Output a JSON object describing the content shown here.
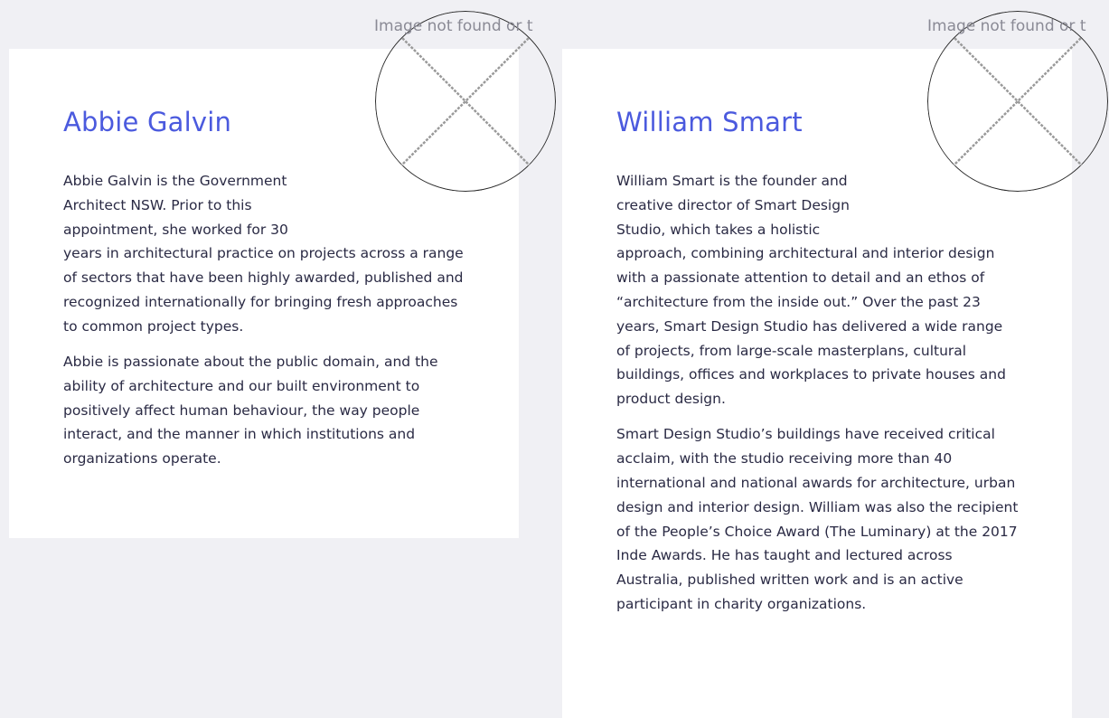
{
  "profiles": [
    {
      "name": "Abbie Galvin",
      "image_alt": "Image not found or t",
      "paragraphs": [
        "Abbie Galvin is the Government Architect NSW. Prior to this appointment, she worked for 30 years in architectural practice on projects across a range of sectors that have been highly awarded, published and recognized internationally for bringing fresh approaches to common project types.",
        "Abbie is passionate about the public domain, and the ability of architecture and our built environment to positively affect human behaviour, the way people interact, and the manner in which institutions and organizations operate."
      ]
    },
    {
      "name": "William Smart",
      "image_alt": "Image not found or t",
      "paragraphs": [
        "William Smart is the founder and creative director of Smart Design Studio, which takes a holistic approach, combining architectural and interior design with a passionate attention to detail and an ethos of “architecture from the inside out.” Over the past 23 years, Smart Design Studio has delivered a wide range of projects, from large-scale masterplans, cultural buildings, offices and workplaces to private houses and product design.",
        "Smart Design Studio’s buildings have received critical acclaim, with the studio receiving more than 40 international and national awards for architecture, urban design and interior design. William was also the recipient of the People’s Choice Award (The Luminary) at the 2017 Inde Awards. He has taught and lectured across Australia, published written work and is an active participant in charity organizations."
      ]
    }
  ],
  "colors": {
    "background": "#f0f0f4",
    "card": "#ffffff",
    "name": "#4b5ade",
    "text": "#2a2a44",
    "placeholder_text": "#8a8a95"
  },
  "icons": {
    "broken_image": "broken-image-icon"
  }
}
